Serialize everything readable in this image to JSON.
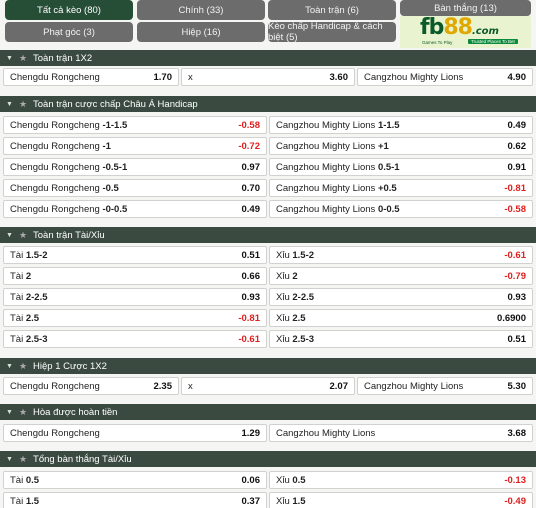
{
  "tabs": [
    {
      "label": "Tất cả kèo (80)",
      "active": true
    },
    {
      "label": "Chính (33)"
    },
    {
      "label": "Toàn trận (6)"
    },
    {
      "label": "Bàn thắng (13)"
    },
    {
      "label": "Phạt góc (3)"
    },
    {
      "label": "Hiệp (16)"
    },
    {
      "label": "Kèo chấp Handicap & cách biệt (5)"
    }
  ],
  "logo": {
    "brand_fb": "fb",
    "brand_num": "88",
    "brand_com": ".com",
    "tagline_left": "Games To Play",
    "tagline_right": "Trusted Places To Bet"
  },
  "sections": {
    "s1": {
      "title": "Toàn trận 1X2",
      "row": [
        {
          "label": "Chengdu Rongcheng",
          "odds": "1.70"
        },
        {
          "label": "x",
          "odds": "3.60"
        },
        {
          "label": "Cangzhou Mighty Lions",
          "odds": "4.90"
        }
      ]
    },
    "s2": {
      "title": "Toàn trận cược chấp Châu Á Handicap",
      "rows": [
        [
          {
            "team": "Chengdu Rongcheng",
            "line": "-1-1.5",
            "odds": "-0.58"
          },
          {
            "team": "Cangzhou Mighty Lions",
            "line": "1-1.5",
            "odds": "0.49"
          }
        ],
        [
          {
            "team": "Chengdu Rongcheng",
            "line": "-1",
            "odds": "-0.72"
          },
          {
            "team": "Cangzhou Mighty Lions",
            "line": "+1",
            "odds": "0.62"
          }
        ],
        [
          {
            "team": "Chengdu Rongcheng",
            "line": "-0.5-1",
            "odds": "0.97"
          },
          {
            "team": "Cangzhou Mighty Lions",
            "line": "0.5-1",
            "odds": "0.91"
          }
        ],
        [
          {
            "team": "Chengdu Rongcheng",
            "line": "-0.5",
            "odds": "0.70"
          },
          {
            "team": "Cangzhou Mighty Lions",
            "line": "+0.5",
            "odds": "-0.81"
          }
        ],
        [
          {
            "team": "Chengdu Rongcheng",
            "line": "-0-0.5",
            "odds": "0.49"
          },
          {
            "team": "Cangzhou Mighty Lions",
            "line": "0-0.5",
            "odds": "-0.58"
          }
        ]
      ]
    },
    "s3": {
      "title": "Toàn trận Tài/Xỉu",
      "rows": [
        [
          {
            "team": "Tài",
            "line": "1.5-2",
            "odds": "0.51"
          },
          {
            "team": "Xỉu",
            "line": "1.5-2",
            "odds": "-0.61"
          }
        ],
        [
          {
            "team": "Tài",
            "line": "2",
            "odds": "0.66"
          },
          {
            "team": "Xỉu",
            "line": "2",
            "odds": "-0.79"
          }
        ],
        [
          {
            "team": "Tài",
            "line": "2-2.5",
            "odds": "0.93"
          },
          {
            "team": "Xỉu",
            "line": "2-2.5",
            "odds": "0.93"
          }
        ],
        [
          {
            "team": "Tài",
            "line": "2.5",
            "odds": "-0.81"
          },
          {
            "team": "Xỉu",
            "line": "2.5",
            "odds": "0.6900"
          }
        ],
        [
          {
            "team": "Tài",
            "line": "2.5-3",
            "odds": "-0.61"
          },
          {
            "team": "Xỉu",
            "line": "2.5-3",
            "odds": "0.51"
          }
        ]
      ]
    },
    "s4": {
      "title": "Hiệp 1 Cược 1X2",
      "row": [
        {
          "label": "Chengdu Rongcheng",
          "odds": "2.35"
        },
        {
          "label": "x",
          "odds": "2.07"
        },
        {
          "label": "Cangzhou Mighty Lions",
          "odds": "5.30"
        }
      ]
    },
    "s5": {
      "title": "Hòa được hoàn tiền",
      "row": [
        {
          "label": "Chengdu Rongcheng",
          "odds": "1.29"
        },
        {
          "label": "Cangzhou Mighty Lions",
          "odds": "3.68"
        }
      ]
    },
    "s6": {
      "title": "Tổng bàn thắng Tài/Xỉu",
      "rows": [
        [
          {
            "team": "Tài",
            "line": "0.5",
            "odds": "0.06"
          },
          {
            "team": "Xỉu",
            "line": "0.5",
            "odds": "-0.13"
          }
        ],
        [
          {
            "team": "Tài",
            "line": "1.5",
            "odds": "0.37"
          },
          {
            "team": "Xỉu",
            "line": "1.5",
            "odds": "-0.49"
          }
        ]
      ]
    }
  },
  "colors": {
    "header_bg": "#3a4a40",
    "active_tab": "#264d36",
    "tab": "#6c6c6c",
    "negative_odds": "#e02020"
  }
}
